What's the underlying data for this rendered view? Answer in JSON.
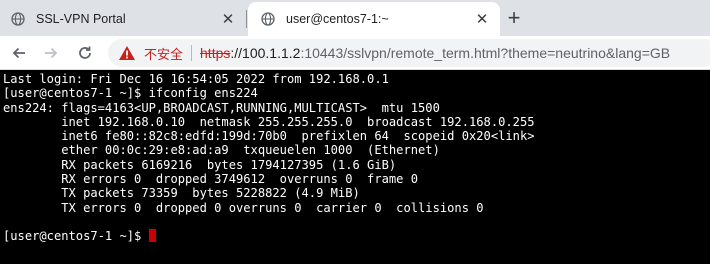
{
  "tabs": [
    {
      "title": "SSL-VPN Portal",
      "favicon": "globe-icon",
      "active": false
    },
    {
      "title": "user@centos7-1:~",
      "favicon": "globe-icon",
      "active": true
    }
  ],
  "new_tab_label": "+",
  "close_label": "✕",
  "address_bar": {
    "security_label": "不安全",
    "scheme": "https",
    "host": "://100.1.1.2",
    "path": ":10443/sslvpn/remote_term.html?theme=neutrino&lang=GB"
  },
  "terminal": {
    "lines": [
      "Last login: Fri Dec 16 16:54:05 2022 from 192.168.0.1",
      "[user@centos7-1 ~]$ ifconfig ens224",
      "ens224: flags=4163<UP,BROADCAST,RUNNING,MULTICAST>  mtu 1500",
      "        inet 192.168.0.10  netmask 255.255.255.0  broadcast 192.168.0.255",
      "        inet6 fe80::82c8:edfd:199d:70b0  prefixlen 64  scopeid 0x20<link>",
      "        ether 00:0c:29:e8:ad:a9  txqueuelen 1000  (Ethernet)",
      "        RX packets 6169216  bytes 1794127395 (1.6 GiB)",
      "        RX errors 0  dropped 3749612  overruns 0  frame 0",
      "        TX packets 73359  bytes 5228822 (4.9 MiB)",
      "        TX errors 0  dropped 0 overruns 0  carrier 0  collisions 0",
      "",
      "[user@centos7-1 ~]$ "
    ],
    "cursor_color": "#cc0000"
  },
  "colors": {
    "tabstrip": "#dee1e6",
    "insecure": "#c5221f",
    "terminal_bg": "#000000",
    "terminal_fg": "#ffffff"
  }
}
